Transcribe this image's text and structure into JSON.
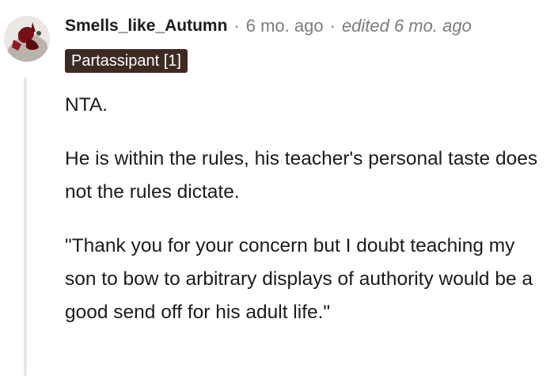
{
  "comment": {
    "author": "Smells_like_Autumn",
    "separator": "·",
    "age": "6 mo. ago",
    "edited": "edited 6 mo. ago",
    "flair": "Partassipant [1]",
    "avatar_icon": "user-avatar-icon",
    "paragraphs": [
      "NTA.",
      "He is within the rules, his teacher's personal taste does not the rules dictate.",
      "\"Thank you for your concern but I doubt teaching my son to bow to arbitrary displays of authority would be a good send off for his adult life.\""
    ]
  },
  "colors": {
    "flair_background": "#3d2b23",
    "meta_text": "#7c7c7c",
    "body_text": "#1c1c1c",
    "thread_line": "#e6e6e6"
  }
}
